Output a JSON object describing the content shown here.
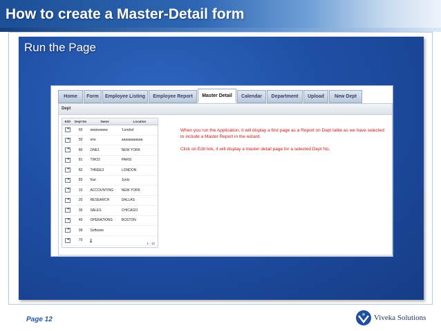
{
  "slide": {
    "title": "How to create a Master-Detail form",
    "subtitle": "Run the Page",
    "page_label": "Page 12",
    "logo_text": "Viveka Solutions"
  },
  "app": {
    "tabs": [
      {
        "label": "Home",
        "active": false
      },
      {
        "label": "Form",
        "active": false
      },
      {
        "label": "Employee Listing",
        "active": false
      },
      {
        "label": "Employee Report",
        "active": false
      },
      {
        "label": "Master Detail",
        "active": true
      },
      {
        "label": "Calendar",
        "active": false
      },
      {
        "label": "Department",
        "active": false
      },
      {
        "label": "Upload",
        "active": false
      },
      {
        "label": "New Dept",
        "active": false
      }
    ],
    "region_title": "Dept",
    "report": {
      "columns": [
        "Edit",
        "Dept No",
        "Name",
        "Location"
      ],
      "rows": [
        {
          "deptno": "60",
          "name": "wwwwwww",
          "loc": "'London'"
        },
        {
          "deptno": "50",
          "name": "one",
          "loc": "aaaaaaaaaaa"
        },
        {
          "deptno": "80",
          "name": "ONE1",
          "loc": "NEW YORK"
        },
        {
          "deptno": "81",
          "name": "TWO2",
          "loc": "PARIS"
        },
        {
          "deptno": "82",
          "name": "THREE3",
          "loc": "LONDON"
        },
        {
          "deptno": "83",
          "name": "four",
          "loc": "Jyots"
        },
        {
          "deptno": "10",
          "name": "ACCOUNTING",
          "loc": "NEW YORK"
        },
        {
          "deptno": "20",
          "name": "RESEARCH",
          "loc": "DALLAS"
        },
        {
          "deptno": "30",
          "name": "SALES",
          "loc": "CHICAGO"
        },
        {
          "deptno": "40",
          "name": "OPERATIONS",
          "loc": "BOSTON"
        },
        {
          "deptno": "99",
          "name": "Software",
          "loc": ""
        },
        {
          "deptno": "70",
          "name": "jj",
          "loc": ""
        }
      ],
      "pagination": "1 - 12"
    },
    "note": [
      "When you run the Application, it will display a first page as a Report on Dept table as we have selected to include a Master Report in the wizard.",
      "Click on Edit link, it will display a master detail page for a selected Dept No."
    ]
  },
  "colors": {
    "title_text": "#ffffff",
    "panel_blue": "#1f4fa5",
    "note_red": "#d01818",
    "page_label_blue": "#1f5aa6"
  },
  "icons": [
    "edit-icon",
    "viveka-logo-icon"
  ]
}
